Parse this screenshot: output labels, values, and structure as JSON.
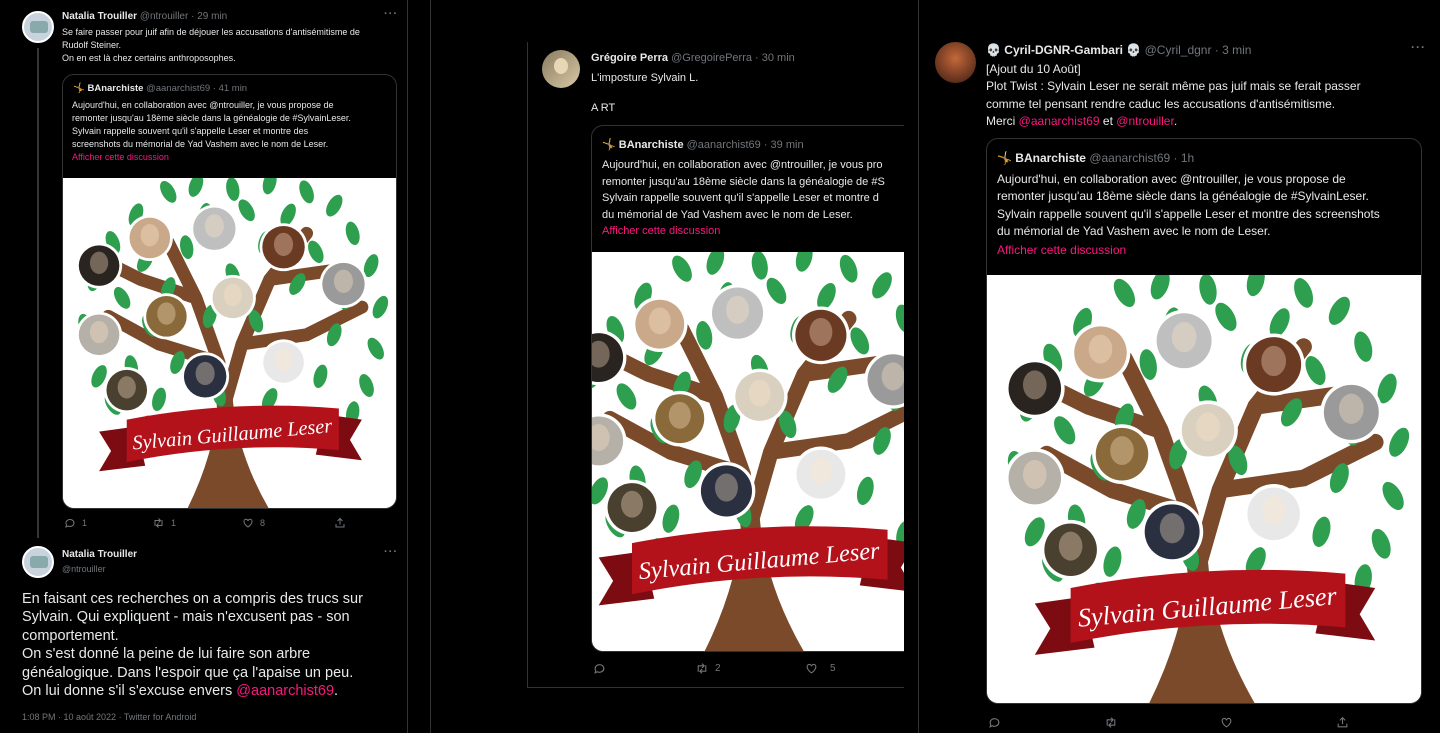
{
  "panel1": {
    "tweet1": {
      "name": "Natalia Trouiller",
      "handle": "@ntrouiller · 29 min",
      "text1": "Se faire passer pour juif afin de déjouer les accusations d'antisémitisme de",
      "text2": "Rudolf Steiner.",
      "text3": "On en est là chez certains anthroposophes.",
      "quote": {
        "name": "BAnarchiste",
        "handle": "@aanarchist69 · 41 min",
        "l1": "Aujourd'hui, en collaboration avec @ntrouiller, je vous propose de",
        "l2": "remonter jusqu'au 18ème siècle dans la généalogie de #SylvainLeser.",
        "l3": "Sylvain rappelle souvent qu'il s'appelle Leser et montre des",
        "l4": "screenshots du mémorial de Yad Vashem avec le nom de Leser.",
        "show": "Afficher cette discussion"
      },
      "banner": "Sylvain Guillaume Leser",
      "replies": "1",
      "retweets": "1",
      "likes": "8"
    },
    "tweet2": {
      "name": "Natalia Trouiller",
      "handle": "@ntrouiller",
      "l1": "En faisant ces recherches on a compris des trucs sur",
      "l2": "Sylvain. Qui expliquent - mais n'excusent pas - son",
      "l3": "comportement.",
      "l4": "On s'est donné la peine de lui faire son arbre",
      "l5": "généalogique. Dans l'espoir que ça l'apaise un peu.",
      "l6a": "On lui donne s'il s'excuse envers ",
      "l6b": "@aanarchist69",
      "l6c": ".",
      "meta": "1:08 PM · 10 août 2022 · Twitter for Android"
    }
  },
  "panel2": {
    "name": "Grégoire Perra",
    "handle": "@GregoirePerra · 30 min",
    "text1": "L'imposture Sylvain L.",
    "text2": "A RT",
    "quote": {
      "name": "BAnarchiste",
      "handle": "@aanarchist69 · 39 min",
      "l1": "Aujourd'hui, en collaboration avec @ntrouiller, je vous pro",
      "l2": "remonter jusqu'au 18ème siècle dans la généalogie de #S",
      "l3": "Sylvain rappelle souvent qu'il s'appelle Leser et montre d",
      "l4": "du mémorial de Yad Vashem avec le nom de Leser.",
      "show": "Afficher cette discussion"
    },
    "banner": "Sylvain Guillaume Leser",
    "retweets": "2",
    "likes": "5"
  },
  "panel3": {
    "name": "💀 Cyril-DGNR-Gambari 💀",
    "handle": "@Cyril_dgnr · 3 min",
    "l1": "[Ajout du 10 Août]",
    "l2": "Plot Twist : Sylvain Leser ne serait même pas juif mais se ferait passer",
    "l3": "comme tel pensant rendre caduc les accusations d'antisémitisme.",
    "l4a": "Merci ",
    "l4b": "@aanarchist69",
    "l4c": " et ",
    "l4d": "@ntrouiller",
    "l4e": ".",
    "quote": {
      "name": "BAnarchiste",
      "handle": "@aanarchist69 · 1h",
      "l1": "Aujourd'hui, en collaboration avec @ntrouiller, je vous propose de",
      "l2": "remonter jusqu'au 18ème siècle dans la généalogie de #SylvainLeser.",
      "l3": "Sylvain rappelle souvent qu'il s'appelle Leser et montre des screenshots",
      "l4": "du mémorial de Yad Vashem avec le nom de Leser.",
      "show": "Afficher cette discussion"
    },
    "banner": "Sylvain Guillaume Leser"
  },
  "colors": {
    "link": "#f91880",
    "muted": "#71767b",
    "leaf": "#2e9e4f",
    "trunk": "#7a4a2a",
    "banner": "#b3121b"
  }
}
